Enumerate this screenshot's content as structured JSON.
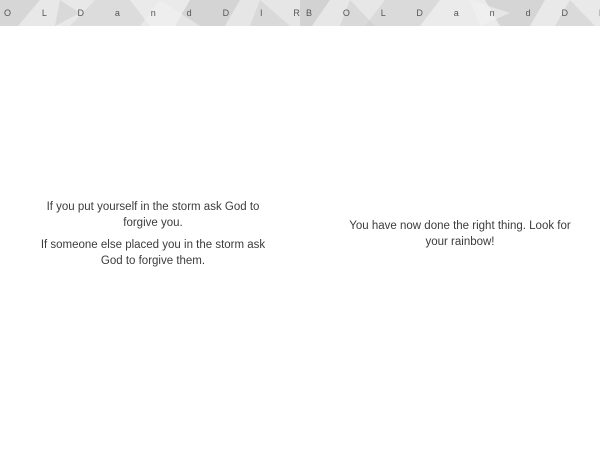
{
  "left_page": {
    "header": "O L D   a n d   D I R E C T",
    "paragraphs": [
      "If you put yourself in the storm ask God to forgive you.",
      "If someone else placed you in the storm ask God to forgive them."
    ]
  },
  "right_page": {
    "header": "B O L D   a n d   D I R E C",
    "paragraphs": [
      "You have now done the right thing.  Look for your rainbow!"
    ]
  },
  "colors": {
    "header_band": "#e3e3e3",
    "header_text": "#555555",
    "body_text": "#3c3c3c",
    "page_background": "#ffffff"
  }
}
